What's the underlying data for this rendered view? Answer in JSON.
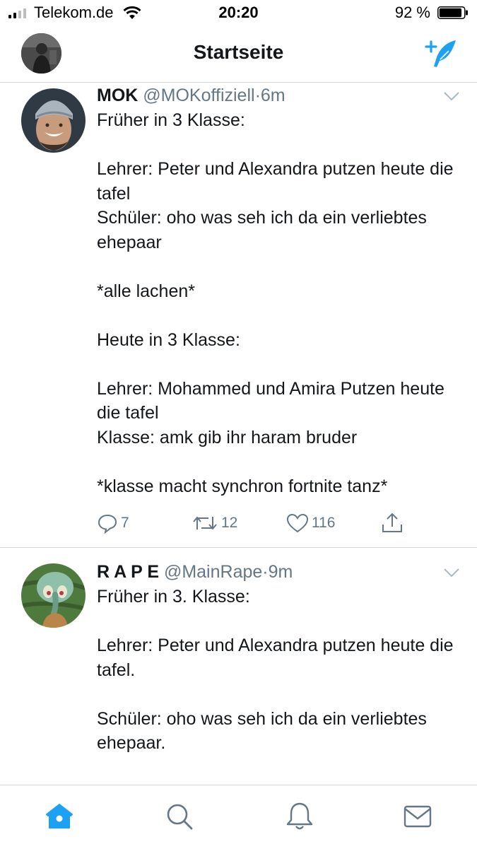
{
  "status_bar": {
    "carrier": "Telekom.de",
    "time": "20:20",
    "battery_percent": "92 %",
    "battery_level": 0.92
  },
  "nav": {
    "title": "Startseite"
  },
  "tweets": [
    {
      "name": "MOK",
      "handle": "@MOKoffiziell",
      "separator": "·",
      "time": "6m",
      "text": "Früher in 3 Klasse:\n\nLehrer: Peter und Alexandra putzen heute die tafel\nSchüler: oho was seh ich da ein verliebtes ehepaar\n\n*alle lachen*\n\nHeute in 3 Klasse:\n\nLehrer: Mohammed und Amira Putzen heute die tafel\nKlasse: amk gib ihr haram bruder\n\n*klasse macht synchron fortnite tanz*",
      "replies": "7",
      "retweets": "12",
      "likes": "116"
    },
    {
      "name": "R A P E",
      "handle": "@MainRape",
      "separator": "·",
      "time": "9m",
      "text": "Früher in 3. Klasse:\n\nLehrer: Peter und Alexandra putzen heute die tafel.\n\nSchüler: oho was seh ich da ein verliebtes ehepaar."
    }
  ],
  "icons": {
    "compose": "compose-tweet-icon",
    "home": "home-icon",
    "search": "search-icon",
    "notifications": "bell-icon",
    "messages": "mail-icon"
  },
  "colors": {
    "accent": "#1da1f2",
    "muted": "#657786",
    "text": "#14171a",
    "divider": "#d5d9dc"
  }
}
